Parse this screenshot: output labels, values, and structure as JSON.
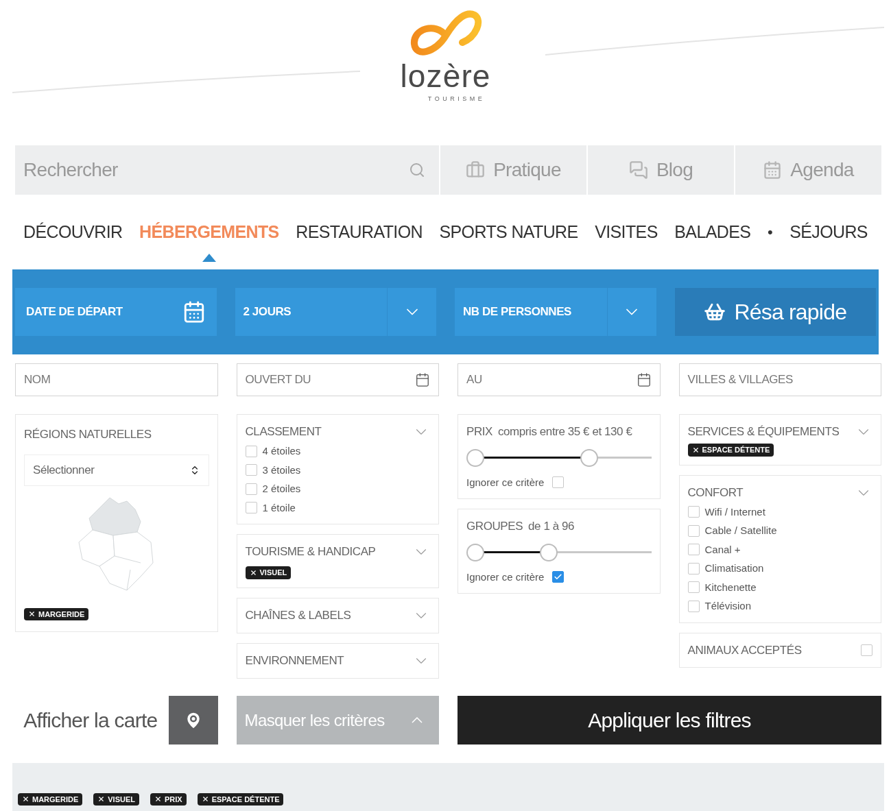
{
  "logo": {
    "name": "lozère",
    "tagline": "TOURISME"
  },
  "topbar": {
    "search": {
      "placeholder": "Rechercher"
    },
    "links": [
      {
        "label": "Pratique",
        "kind": "briefcase"
      },
      {
        "label": "Blog",
        "kind": "chat"
      },
      {
        "label": "Agenda",
        "kind": "calendar"
      }
    ]
  },
  "nav": [
    {
      "label": "DÉCOUVRIR",
      "kind": "link",
      "selected": false
    },
    {
      "label": "HÉBERGEMENTS",
      "kind": "link",
      "selected": true
    },
    {
      "label": "RESTAURATION",
      "kind": "link",
      "selected": false
    },
    {
      "label": "SPORTS NATURE",
      "kind": "link",
      "selected": false
    },
    {
      "label": "VISITES",
      "kind": "link",
      "selected": false
    },
    {
      "label": "BALADES",
      "kind": "link",
      "selected": false
    },
    {
      "label": "•",
      "kind": "separator"
    },
    {
      "label": "SÉJOURS",
      "kind": "link",
      "selected": false
    }
  ],
  "booking": {
    "date": {
      "placeholder": "DATE DE DÉPART"
    },
    "duration": {
      "value": "2 JOURS"
    },
    "persons": {
      "placeholder": "NB DE PERSONNES"
    },
    "button": "Résa rapide"
  },
  "fields": [
    {
      "placeholder": "NOM",
      "kind": "text"
    },
    {
      "placeholder": "OUVERT DU",
      "kind": "date"
    },
    {
      "placeholder": "AU",
      "kind": "date"
    },
    {
      "placeholder": "VILLES & VILLAGES",
      "kind": "text"
    }
  ],
  "regions": {
    "title": "RÉGIONS NATURELLES",
    "select": {
      "placeholder": "Sélectionner"
    },
    "tags": [
      "MARGERIDE"
    ]
  },
  "classement": {
    "title": "CLASSEMENT",
    "options": [
      {
        "label": "4 étoiles",
        "checked": false
      },
      {
        "label": "3 étoiles",
        "checked": false
      },
      {
        "label": "2 étoiles",
        "checked": false
      },
      {
        "label": "1 étoile",
        "checked": false
      }
    ]
  },
  "tourisme_handicap": {
    "title": "TOURISME & HANDICAP",
    "tags": [
      "VISUEL"
    ]
  },
  "chaines_labels": {
    "title": "CHAÎNES & LABELS"
  },
  "environnement": {
    "title": "ENVIRONNEMENT"
  },
  "ranges": [
    {
      "label": "PRIX",
      "detail": "compris entre 35 € et 130 €",
      "thumbs": [
        {
          "level": 0
        },
        {
          "level": 0.68
        }
      ],
      "ignore": {
        "label": "Ignorer ce critère",
        "checked": false
      }
    },
    {
      "label": "GROUPES",
      "detail": "de 1 à 96",
      "thumbs": [
        {
          "level": 0
        },
        {
          "level": 0.44
        }
      ],
      "ignore": {
        "label": "Ignorer ce critère",
        "checked": true
      }
    }
  ],
  "services": {
    "title": "SERVICES & ÉQUIPEMENTS",
    "tags": [
      "ESPACE DÉTENTE"
    ]
  },
  "confort": {
    "title": "CONFORT",
    "options": [
      {
        "label": "Wifi / Internet",
        "checked": false
      },
      {
        "label": "Cable / Satellite",
        "checked": false
      },
      {
        "label": "Canal +",
        "checked": false
      },
      {
        "label": "Climatisation",
        "checked": false
      },
      {
        "label": "Kitchenette",
        "checked": false
      },
      {
        "label": "Télévision",
        "checked": false
      }
    ]
  },
  "animaux": {
    "label": "ANIMAUX ACCEPTÉS",
    "checked": false
  },
  "actions": {
    "map_label": "Afficher la carte",
    "hide": "Masquer les critères",
    "apply": "Appliquer les filtres"
  },
  "active_tags": [
    "MARGERIDE",
    "VISUEL",
    "PRIX",
    "ESPACE DÉTENTE"
  ]
}
